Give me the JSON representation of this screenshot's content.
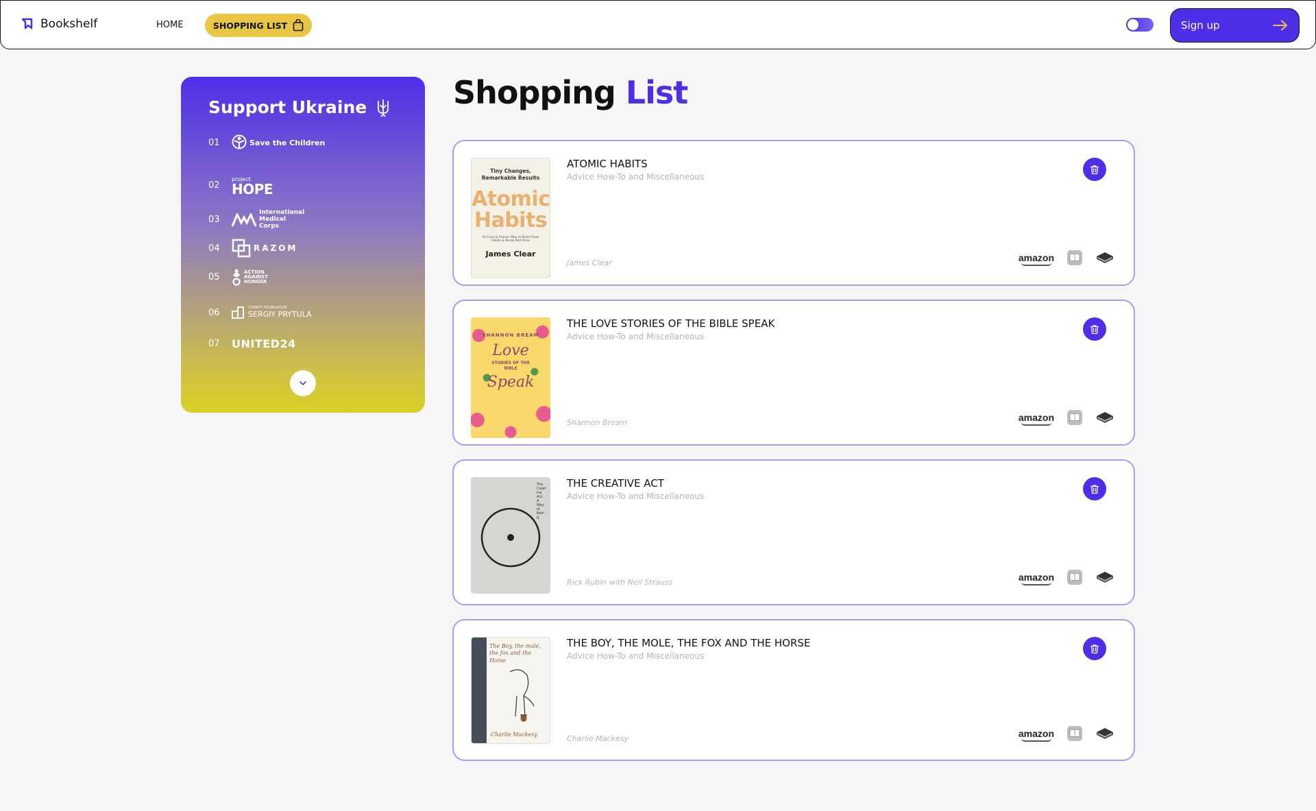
{
  "header": {
    "brand": "Bookshelf",
    "nav_home": "HOME",
    "nav_shopping": "SHOPPING LIST",
    "signup_label": "Sign up",
    "theme_toggle": "light"
  },
  "support": {
    "title": "Support Ukraine",
    "funds": [
      {
        "num": "01",
        "name": "Save the Children"
      },
      {
        "num": "02",
        "name": "HOPE",
        "prefix": "project"
      },
      {
        "num": "03",
        "name": "International Medical Corps"
      },
      {
        "num": "04",
        "name": "RAZOM"
      },
      {
        "num": "05",
        "name": "ACTION AGAINST HUNGER"
      },
      {
        "num": "06",
        "name": "SERGIY PRYTULA",
        "prefix": "CHARITY FOUNDATION"
      },
      {
        "num": "07",
        "name": "UNITED24"
      }
    ]
  },
  "page": {
    "title_part1": "Shopping",
    "title_part2": "List"
  },
  "books": [
    {
      "title": "ATOMIC HABITS",
      "category": "Advice How-To and Miscellaneous",
      "author": "James Clear",
      "cover": {
        "top": "Tiny Changes, Remarkable Results",
        "main1": "Atomic",
        "main2": "Habits",
        "sub": "An Easy & Proven Way to Build Good Habits & Break Bad Ones",
        "author": "James Clear"
      }
    },
    {
      "title": "THE LOVE STORIES OF THE BIBLE SPEAK",
      "category": "Advice How-To and Miscellaneous",
      "author": "Shannon Bream",
      "cover": {
        "top": "SHANNON BREAM",
        "main1": "Love",
        "main2": "Speak",
        "sub": "STORIES OF THE BIBLE"
      }
    },
    {
      "title": "THE CREATIVE ACT",
      "category": "Advice How-To and Miscellaneous",
      "author": "Rick Rubin with Neil Strauss",
      "cover": {
        "side": "The Creative Act: A Way of Being"
      }
    },
    {
      "title": "THE BOY, THE MOLE, THE FOX AND THE HORSE",
      "category": "Advice How-To and Miscellaneous",
      "author": "Charlie Mackesy",
      "cover": {
        "top": "The Boy, the mole, the fox and the Horse",
        "author": "Charlie Mackesy"
      }
    }
  ],
  "shops": [
    "amazon",
    "apple-books-icon",
    "bookshop-icon"
  ],
  "colors": {
    "accent": "#4f2ee8",
    "yellow": "#eac645",
    "card_border": "#a99cf0"
  }
}
